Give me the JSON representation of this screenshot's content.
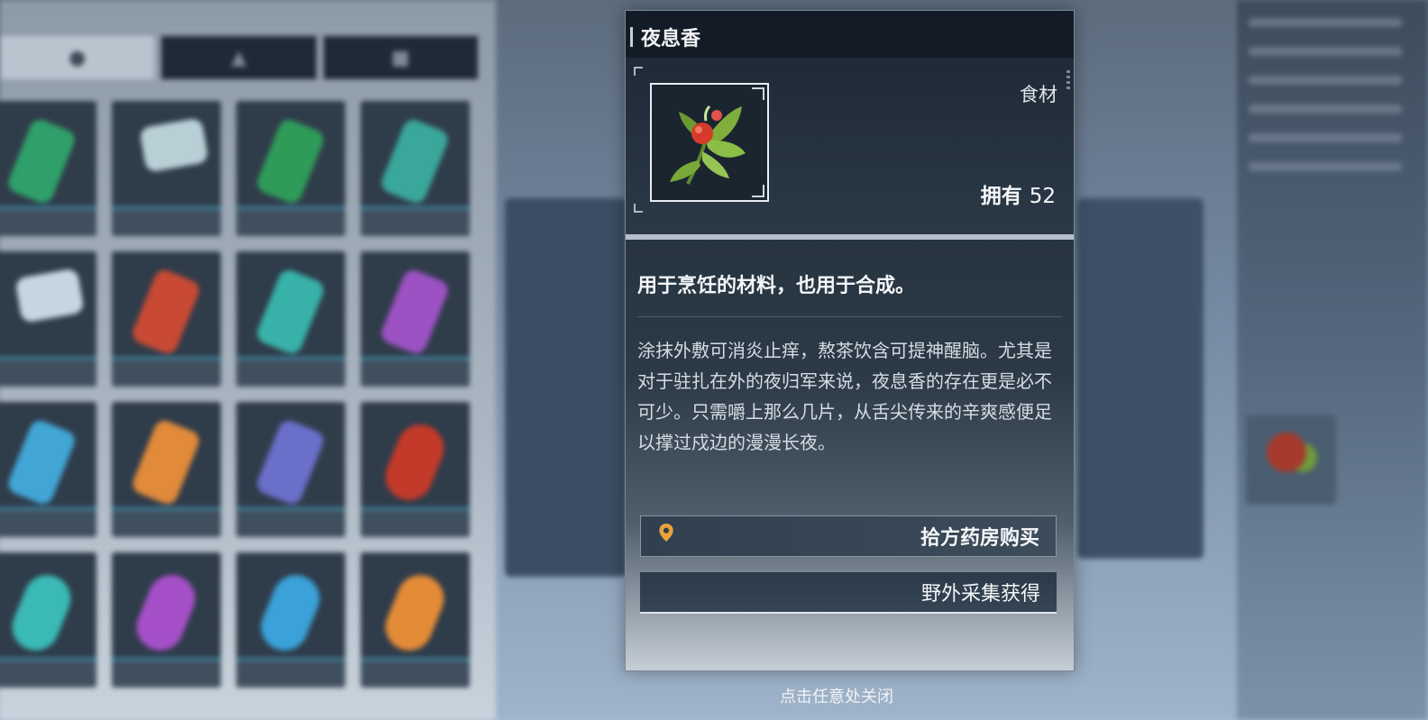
{
  "item": {
    "name": "夜息香",
    "category": "食材",
    "owned_label": "拥有",
    "owned_count": "52",
    "short_description": "用于烹饪的材料，也用于合成。",
    "long_description": "涂抹外敷可消炎止痒，熬茶饮含可提神醒脑。尤其是对于驻扎在外的夜归军来说，夜息香的存在更是必不可少。只需嚼上那么几片，从舌尖传来的辛爽感便足以撑过戍边的漫漫长夜。",
    "icon": "red-flower-herb-icon"
  },
  "sources": [
    {
      "label": "拾方药房购买",
      "icon": "location-pin-icon",
      "color": "#e8a33a"
    },
    {
      "label": "野外采集获得"
    }
  ],
  "close_hint": "点击任意处关闭",
  "colors": {
    "accent_pin": "#e8a33a",
    "panel_dark": "#131c26"
  }
}
